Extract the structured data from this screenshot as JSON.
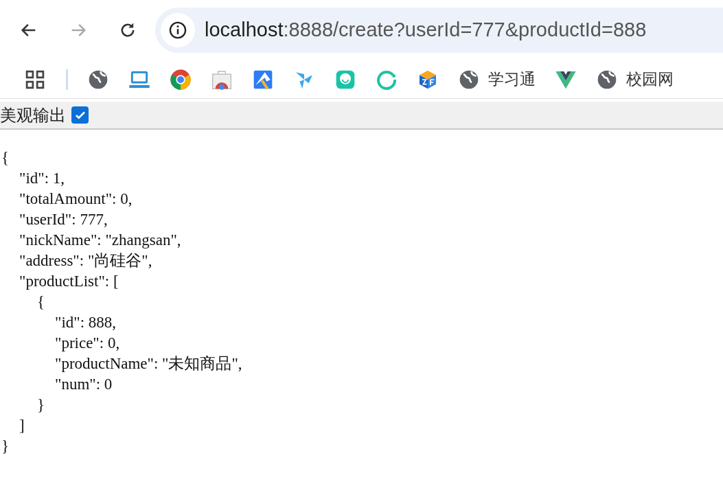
{
  "address_bar": {
    "host": "localhost",
    "path": ":8888/create?userId=777&productId=888"
  },
  "bookmarks": [
    {
      "kind": "globe"
    },
    {
      "kind": "laptop"
    },
    {
      "kind": "chrome"
    },
    {
      "kind": "store"
    },
    {
      "kind": "kite"
    },
    {
      "kind": "fan"
    },
    {
      "kind": "face"
    },
    {
      "kind": "ring"
    },
    {
      "kind": "cube"
    },
    {
      "kind": "globe",
      "label": "学习通"
    },
    {
      "kind": "vue"
    },
    {
      "kind": "globe",
      "label": "校园网"
    }
  ],
  "toolbar": {
    "label": "美观输出",
    "checked": true
  },
  "json_view": {
    "lines": [
      {
        "text": "{",
        "children": [
          {
            "text": "\"id\": 1,"
          },
          {
            "text": "\"totalAmount\": 0,"
          },
          {
            "text": "\"userId\": 777,"
          },
          {
            "text": "\"nickName\": \"zhangsan\","
          },
          {
            "text": "\"address\": \"尚硅谷\","
          },
          {
            "text": "\"productList\": [",
            "children": [
              {
                "text": "{",
                "children": [
                  {
                    "text": "\"id\": 888,"
                  },
                  {
                    "text": "\"price\": 0,"
                  },
                  {
                    "text": "\"productName\": \"未知商品\","
                  },
                  {
                    "text": "\"num\": 0"
                  }
                ]
              },
              {
                "text": "}"
              }
            ]
          },
          {
            "text": "]"
          }
        ]
      },
      {
        "text": "}"
      }
    ]
  }
}
